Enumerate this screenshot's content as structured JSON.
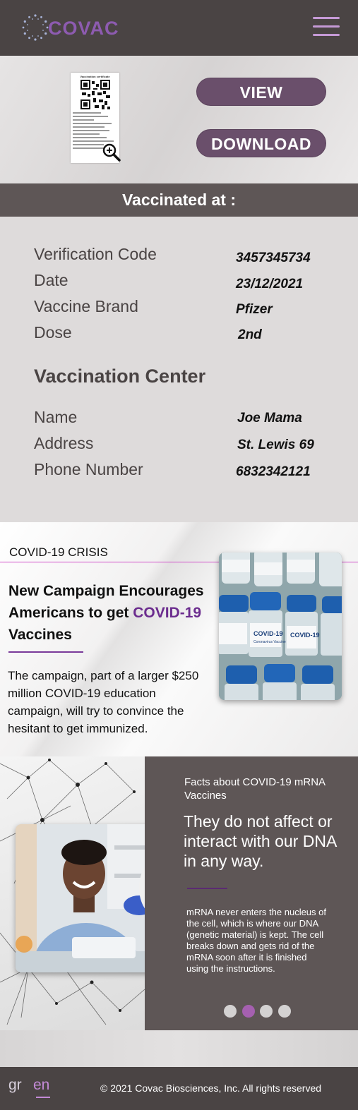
{
  "header": {
    "logo_text": "COVAC",
    "menu_icon": "hamburger-menu-icon",
    "logo_color": "#8d5bb0"
  },
  "certificate": {
    "thumbnail_title": "Vaccination certificate",
    "zoom_icon": "zoom-in-icon",
    "view_label": "VIEW",
    "download_label": "DOWNLOAD",
    "button_color": "#6a4f6b"
  },
  "vaccinated_bar": {
    "title": "Vaccinated at :"
  },
  "vaccination": {
    "rows": [
      {
        "label": "Verification Code",
        "value": "3457345734"
      },
      {
        "label": "Date",
        "value": "23/12/2021"
      },
      {
        "label": "Vaccine Brand",
        "value": "Pfizer"
      },
      {
        "label": "Dose",
        "value": "2nd"
      }
    ]
  },
  "center": {
    "title": "Vaccination Center",
    "rows": [
      {
        "label": "Name",
        "value": "Joe Mama"
      },
      {
        "label": "Address",
        "value": "St. Lewis 69"
      },
      {
        "label": "Phone Number",
        "value": "6832342121"
      }
    ]
  },
  "news": {
    "kicker": "COVID-19 CRISIS",
    "title_part1": "New Campaign Encourages Americans to get ",
    "title_highlight": "COVID-19",
    "title_part2": " Vaccines",
    "body": "The campaign, part of a larger $250 million COVID-19 education campaign, will try to convince the hesitant to get immunized.",
    "image_label": "COVID-19",
    "image_sub": "Coronavirus Vaccine",
    "accent_color": "#d04fc9"
  },
  "facts": {
    "kicker": "Facts about COVID-19 mRNA Vaccines",
    "headline": "They do not affect or interact with our DNA in any way.",
    "body": "mRNA never enters the nucleus of the cell, which is where our DNA (genetic material) is kept. The cell breaks down and gets rid of the mRNA soon after it is finished using the instructions.",
    "carousel_active": 2,
    "carousel_total": 4
  },
  "footer": {
    "lang_gr": "gr",
    "lang_en": "en",
    "copyright": "© 2021 Covac Biosciences, Inc. All rights reserved"
  }
}
